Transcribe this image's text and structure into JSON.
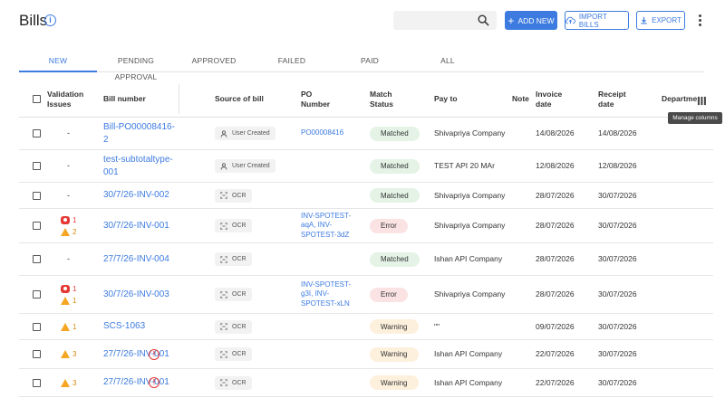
{
  "header": {
    "title": "Bills",
    "search_placeholder": "",
    "add_label": "ADD NEW",
    "import_label": "IMPORT BILLS",
    "export_label": "EXPORT"
  },
  "tabs": [
    "NEW",
    "PENDING APPROVAL",
    "APPROVED",
    "FAILED",
    "PAID",
    "ALL"
  ],
  "active_tab": "NEW",
  "columns": {
    "validation": "Validation Issues",
    "bill_number": "Bill number",
    "source": "Source of bill",
    "po_number": "PO Number",
    "match_status": "Match Status",
    "pay_to": "Pay to",
    "note": "Note",
    "invoice_date": "Invoice date",
    "receipt_date": "Receipt date",
    "department": "Departme"
  },
  "tooltip": "Manage columns",
  "rows": [
    {
      "validation": "-",
      "bill": "Bill-PO00008416-2",
      "source": "User Created",
      "po": "PO00008416",
      "status": "Matched",
      "pay_to": "Shivapriya Company",
      "invoice_date": "14/08/2026",
      "receipt_date": "14/08/2026"
    },
    {
      "validation": "-",
      "bill": "test-subtotaltype-001",
      "source": "User Created",
      "po": "",
      "status": "Matched",
      "pay_to": "TEST API 20 MAr",
      "invoice_date": "12/08/2026",
      "receipt_date": "12/08/2026"
    },
    {
      "validation": "-",
      "bill": "30/7/26-INV-002",
      "source": "OCR",
      "po": "",
      "status": "Matched",
      "pay_to": "Shivapriya Company",
      "invoice_date": "28/07/2026",
      "receipt_date": "30/07/2026"
    },
    {
      "errors": "1",
      "warnings": "2",
      "bill": "30/7/26-INV-001",
      "source": "OCR",
      "po": "INV-SPOTEST-aqA, INV-SPOTEST-3dZ",
      "status": "Error",
      "pay_to": "Shivapriya Company",
      "invoice_date": "28/07/2026",
      "receipt_date": "30/07/2026"
    },
    {
      "validation": "-",
      "bill": "27/7/26-INV-004",
      "source": "OCR",
      "po": "",
      "status": "Matched",
      "pay_to": "Ishan API Company",
      "invoice_date": "28/07/2026",
      "receipt_date": "30/07/2026"
    },
    {
      "errors": "1",
      "warnings": "1",
      "bill": "30/7/26-INV-003",
      "source": "OCR",
      "po": "INV-SPOTEST-g3I, INV-SPOTEST-xLN",
      "status": "Error",
      "pay_to": "Shivapriya Company",
      "invoice_date": "28/07/2026",
      "receipt_date": "30/07/2026"
    },
    {
      "warnings": "1",
      "bill": "SCS-1063",
      "source": "OCR",
      "po": "",
      "status": "Warning",
      "pay_to": "\"\"",
      "invoice_date": "09/07/2026",
      "receipt_date": "30/07/2026"
    },
    {
      "warnings": "3",
      "bill": "27/7/26-INV-001",
      "source": "OCR",
      "po": "",
      "status": "Warning",
      "pay_to": "Ishan API Company",
      "invoice_date": "22/07/2026",
      "receipt_date": "30/07/2026",
      "alert": true
    },
    {
      "warnings": "3",
      "bill": "27/7/26-INV-001",
      "source": "OCR",
      "po": "",
      "status": "Warning",
      "pay_to": "Ishan API Company",
      "invoice_date": "22/07/2026",
      "receipt_date": "30/07/2026",
      "alert": true
    }
  ]
}
